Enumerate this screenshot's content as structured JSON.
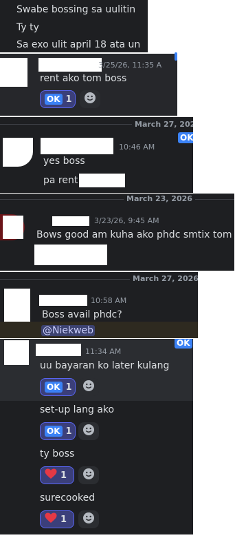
{
  "panel1": {
    "lines": [
      "Swabe bossing sa uulitin",
      "Ty ty",
      "Sa exo ulit april 18 ata un"
    ]
  },
  "panel2": {
    "timestamp": "3/25/26, 11:35 A",
    "message": "rent ako tom boss",
    "reaction": {
      "emoji": "OK",
      "count": "1"
    }
  },
  "panel3": {
    "date": "March 27, 2026",
    "timestamp": "10:46 AM",
    "lines": [
      "yes boss",
      "pa rent"
    ],
    "ok_badge": "OK"
  },
  "panel4": {
    "date": "March 23, 2026",
    "timestamp": "3/23/26, 9:45 AM",
    "message": "Bows good am kuha ako phdc smtix tom"
  },
  "panel5": {
    "date": "March 27, 2026",
    "timestamp": "10:58 AM",
    "message": "Boss avail phdc?",
    "mention": "@Niekweb"
  },
  "panel6": {
    "timestamp": "11:34 AM",
    "ok_badge": "OK",
    "messages": [
      {
        "text": "uu bayaran ko later kulang",
        "reaction": "OK",
        "count": "1"
      },
      {
        "text": "set-up lang ako",
        "reaction": "OK",
        "count": "1"
      },
      {
        "text": "ty boss",
        "reaction": "heart",
        "count": "1"
      },
      {
        "text": "surecooked",
        "reaction": "heart",
        "count": "1"
      }
    ]
  },
  "colors": {
    "bg": "#1e1f22",
    "bg_alt": "#2b2d31",
    "accent": "#5865f2",
    "ok": "#3b82f6",
    "heart": "#e53945"
  }
}
